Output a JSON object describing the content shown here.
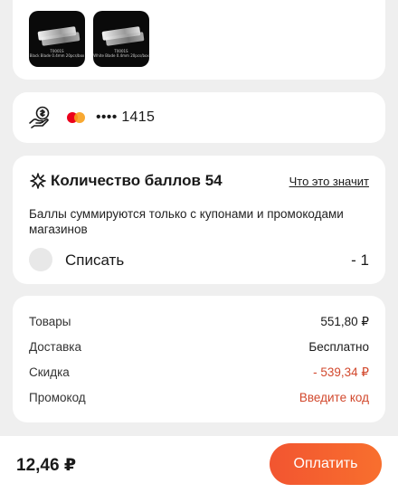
{
  "products": {
    "items": [
      {
        "caption_line1": "T0001S",
        "caption_line2": "Black Blade 0.4mm 20pcs/box"
      },
      {
        "caption_line1": "T0001S",
        "caption_line2": "White Blade 0.4mm 20pcs/box"
      }
    ]
  },
  "payment": {
    "card_icon": "mastercard-logo",
    "card_number": "•••• 1415"
  },
  "points": {
    "title": "Количество баллов 54",
    "help_link": "Что это значит",
    "description": "Баллы суммируются только с купонами и промокодами магазинов",
    "spend_label": "Списать",
    "spend_value": "- 1"
  },
  "summary": {
    "goods_label": "Товары",
    "goods_value": "551,80 ₽",
    "delivery_label": "Доставка",
    "delivery_value": "Бесплатно",
    "discount_label": "Скидка",
    "discount_value": "- 539,34 ₽",
    "promo_label": "Промокод",
    "promo_value": "Введите код"
  },
  "footer": {
    "total": "12,46 ₽",
    "pay_button": "Оплатить"
  },
  "colors": {
    "accent": "#f25530",
    "discount": "#d2482d",
    "background": "#efefef"
  }
}
